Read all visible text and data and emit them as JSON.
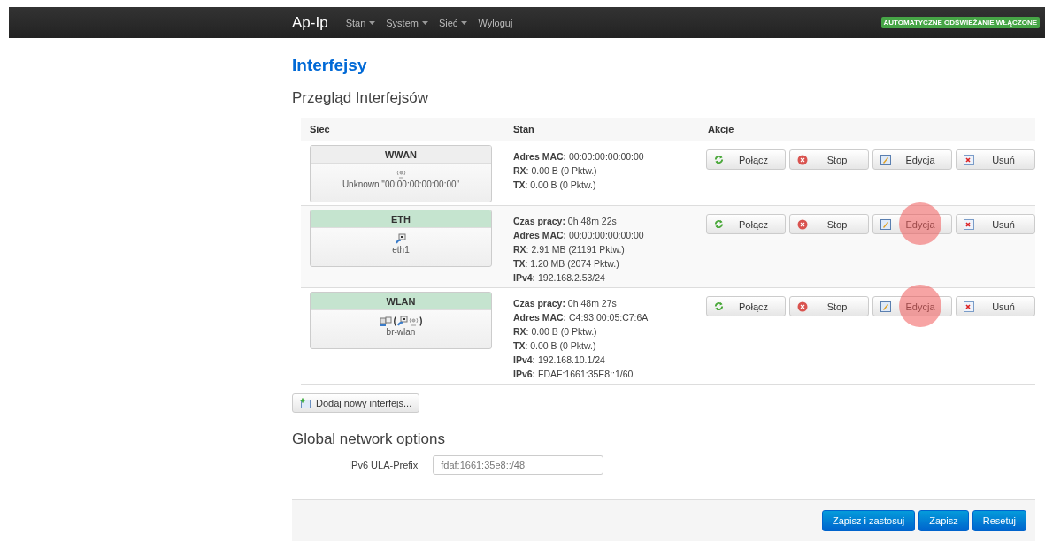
{
  "navbar": {
    "brand": "Ap-Ip",
    "menu": [
      {
        "label": "Stan",
        "dropdown": true
      },
      {
        "label": "System",
        "dropdown": true
      },
      {
        "label": "Sieć",
        "dropdown": true
      },
      {
        "label": "Wyloguj",
        "dropdown": false
      }
    ],
    "badge": "AUTOMATYCZNE ODŚWIEŻANIE WŁĄCZONE"
  },
  "page_title": "Interfejsy",
  "section_title": "Przegląd Interfejsów",
  "table": {
    "columns": [
      "Sieć",
      "Stan",
      "Akcje"
    ],
    "rows": [
      {
        "name": "WWAN",
        "color": "#eeeeee",
        "icon": {
          "kind": "wireless"
        },
        "device": "Unknown \"00:00:00:00:00:00\"",
        "status": [
          "**Adres MAC:** 00:00:00:00:00:00",
          "**RX**: 0.00 B (0 Pktw.)",
          "**TX**: 0.00 B (0 Pktw.)"
        ],
        "actions": [
          {
            "kind": "connect",
            "label": "Połącz",
            "highlighted": false
          },
          {
            "kind": "stop",
            "label": "Stop",
            "highlighted": false
          },
          {
            "kind": "edit",
            "label": "Edycja",
            "highlighted": false
          },
          {
            "kind": "delete",
            "label": "Usuń",
            "highlighted": false
          }
        ]
      },
      {
        "name": "ETH",
        "color": "#c5e4cf",
        "icon": {
          "kind": "ethernet"
        },
        "device": "eth1",
        "status": [
          "**Czas pracy:** 0h 48m 22s",
          "**Adres MAC:** 00:00:00:00:00:00",
          "**RX**: 2.91 MB (21191 Pktw.)",
          "**TX**: 1.20 MB (2074 Pktw.)",
          "**IPv4:** 192.168.2.53/24"
        ],
        "actions": [
          {
            "kind": "connect",
            "label": "Połącz",
            "highlighted": false
          },
          {
            "kind": "stop",
            "label": "Stop",
            "highlighted": false
          },
          {
            "kind": "edit",
            "label": "Edycja",
            "highlighted": true
          },
          {
            "kind": "delete",
            "label": "Usuń",
            "highlighted": false
          }
        ]
      },
      {
        "name": "WLAN",
        "color": "#c5e4cf",
        "icon": {
          "kind": "bridge",
          "members": [
            {
              "kind": "ethernet"
            },
            {
              "kind": "wireless"
            }
          ]
        },
        "device": "br-wlan",
        "status": [
          "**Czas pracy:** 0h 48m 27s",
          "**Adres MAC:** C4:93:00:05:C7:6A",
          "**RX**: 0.00 B (0 Pktw.)",
          "**TX**: 0.00 B (0 Pktw.)",
          "**IPv4:** 192.168.10.1/24",
          "**IPv6:** FDAF:1661:35E8::1/60"
        ],
        "actions": [
          {
            "kind": "connect",
            "label": "Połącz",
            "highlighted": false
          },
          {
            "kind": "stop",
            "label": "Stop",
            "highlighted": false
          },
          {
            "kind": "edit",
            "label": "Edycja",
            "highlighted": true
          },
          {
            "kind": "delete",
            "label": "Usuń",
            "highlighted": false
          }
        ]
      }
    ]
  },
  "add_button": "Dodaj nowy interfejs...",
  "global_title": "Global network options",
  "ula_field": {
    "label": "IPv6 ULA-Prefix",
    "value": "fdaf:1661:35e8::/48"
  },
  "footer_buttons": [
    "Zapisz i zastosuj",
    "Zapisz",
    "Resetuj"
  ]
}
